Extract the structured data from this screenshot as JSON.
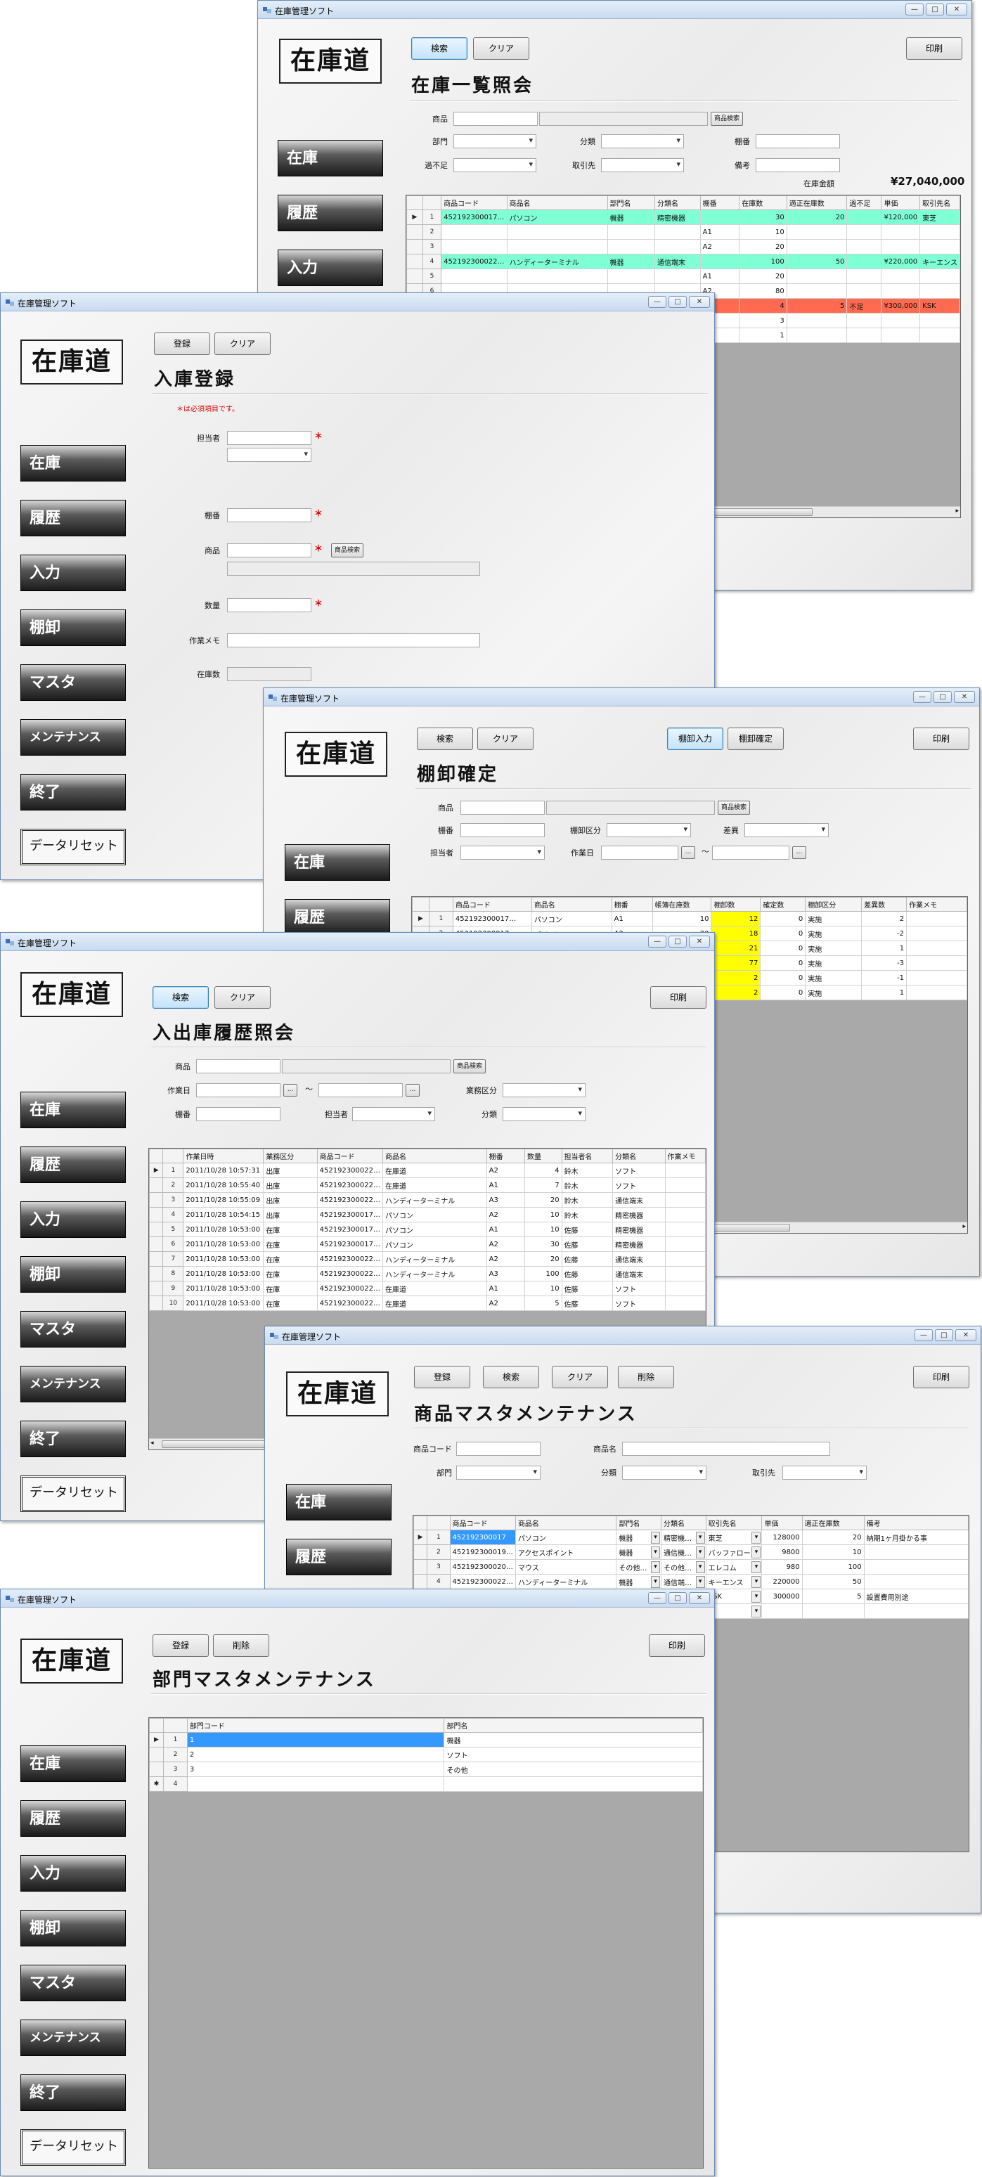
{
  "app_title": "在庫管理ソフト",
  "logo_text": "在庫道",
  "win_controls": {
    "minimize": "—",
    "maximize": "□",
    "close": "✕"
  },
  "menu": {
    "stock": "在庫",
    "history": "履歴",
    "input": "入力",
    "tanaoroshi": "棚卸",
    "master": "マスタ",
    "maint": "メンテナンス",
    "exit": "終了",
    "reset": "データリセット"
  },
  "w1": {
    "btn_search": "検索",
    "btn_clear": "クリア",
    "btn_print": "印刷",
    "page_title": "在庫一覧照会",
    "f_product": "商品",
    "btn_prod_search": "商品検索",
    "f_dept": "部門",
    "f_cat": "分類",
    "f_shelf": "棚番",
    "f_lack": "過不足",
    "f_supplier": "取引先",
    "f_note": "備考",
    "total_label": "在庫金額",
    "total_value": "¥27,040,000",
    "cols": [
      "商品コード",
      "商品名",
      "部門名",
      "分類名",
      "棚番",
      "在庫数",
      "適正在庫数",
      "過不足",
      "単価",
      "取引先名"
    ],
    "rows": [
      {
        "n": "1",
        "cells": [
          "452192300017…",
          "パソコン",
          "機器",
          "精密機器",
          "",
          "30",
          "20",
          "",
          "¥120,000",
          "東芝"
        ]
      },
      {
        "n": "2",
        "cells": [
          "",
          "",
          "",
          "",
          "A1",
          "10",
          "",
          "",
          "",
          ""
        ]
      },
      {
        "n": "3",
        "cells": [
          "",
          "",
          "",
          "",
          "A2",
          "20",
          "",
          "",
          "",
          ""
        ]
      },
      {
        "n": "4",
        "cells": [
          "452192300022…",
          "ハンディーターミナル",
          "機器",
          "通信端末",
          "",
          "100",
          "50",
          "",
          "¥220,000",
          "キーエンス"
        ]
      },
      {
        "n": "5",
        "cells": [
          "",
          "",
          "",
          "",
          "A1",
          "20",
          "",
          "",
          "",
          ""
        ]
      },
      {
        "n": "6",
        "cells": [
          "",
          "",
          "",
          "",
          "A2",
          "80",
          "",
          "",
          "",
          ""
        ]
      },
      {
        "n": "7",
        "cells": [
          "",
          "",
          "",
          "",
          "",
          "4",
          "5",
          "不足",
          "¥300,000",
          "KSK"
        ]
      },
      {
        "n": "8",
        "cells": [
          "",
          "",
          "",
          "",
          "",
          "3",
          "",
          "",
          "",
          ""
        ]
      },
      {
        "n": "9",
        "cells": [
          "",
          "",
          "",
          "",
          "",
          "1",
          "",
          "",
          "",
          ""
        ]
      }
    ]
  },
  "w2": {
    "btn_register": "登録",
    "btn_clear": "クリア",
    "page_title": "入庫登録",
    "required_note": "＊は必須項目です。",
    "f_person": "担当者",
    "f_shelf": "棚番",
    "f_product": "商品",
    "btn_prod_search": "商品検索",
    "f_qty": "数量",
    "f_memo": "作業メモ",
    "f_stock": "在庫数",
    "req_mark": "＊"
  },
  "w3": {
    "btn_search": "検索",
    "btn_clear": "クリア",
    "btn_input": "棚卸入力",
    "btn_confirm": "棚卸確定",
    "btn_print": "印刷",
    "page_title": "棚卸確定",
    "f_product": "商品",
    "btn_prod_search": "商品検索",
    "f_shelf": "棚番",
    "f_tkubun": "棚卸区分",
    "f_diff": "差異",
    "f_person": "担当者",
    "f_workdate": "作業日",
    "tilde": "～",
    "ellipsis": "...",
    "cols": [
      "商品コード",
      "商品名",
      "棚番",
      "帳簿在庫数",
      "棚卸数",
      "確定数",
      "棚卸区分",
      "差異数",
      "作業メモ"
    ],
    "rows": [
      {
        "n": "1",
        "cells": [
          "452192300017…",
          "パソコン",
          "A1",
          "10",
          "12",
          "0",
          "実施",
          "2",
          ""
        ]
      },
      {
        "n": "2",
        "cells": [
          "452192300017…",
          "パソコン",
          "A2",
          "20",
          "18",
          "0",
          "実施",
          "-2",
          ""
        ]
      },
      {
        "n": "3",
        "cells": [
          "",
          "",
          "",
          "",
          "21",
          "0",
          "実施",
          "1",
          ""
        ]
      },
      {
        "n": "4",
        "cells": [
          "",
          "",
          "",
          "",
          "77",
          "0",
          "実施",
          "-3",
          ""
        ]
      },
      {
        "n": "5",
        "cells": [
          "",
          "",
          "",
          "",
          "2",
          "0",
          "実施",
          "-1",
          ""
        ]
      },
      {
        "n": "6",
        "cells": [
          "",
          "",
          "",
          "",
          "2",
          "0",
          "実施",
          "1",
          ""
        ]
      }
    ]
  },
  "w4": {
    "btn_search": "検索",
    "btn_clear": "クリア",
    "btn_print": "印刷",
    "page_title": "入出庫履歴照会",
    "f_product": "商品",
    "btn_prod_search": "商品検索",
    "f_workdate": "作業日",
    "tilde": "～",
    "ellipsis": "...",
    "f_gyomu": "業務区分",
    "f_shelf": "棚番",
    "f_person": "担当者",
    "f_cat": "分類",
    "cols": [
      "作業日時",
      "業務区分",
      "商品コード",
      "商品名",
      "棚番",
      "数量",
      "担当者名",
      "分類名",
      "作業メモ"
    ],
    "rows": [
      {
        "n": "1",
        "cells": [
          "2011/10/28 10:57:31",
          "出庫",
          "452192300022…",
          "在庫道",
          "A2",
          "4",
          "鈴木",
          "ソフト",
          ""
        ]
      },
      {
        "n": "2",
        "cells": [
          "2011/10/28 10:55:40",
          "出庫",
          "452192300022…",
          "在庫道",
          "A1",
          "7",
          "鈴木",
          "ソフト",
          ""
        ]
      },
      {
        "n": "3",
        "cells": [
          "2011/10/28 10:55:09",
          "出庫",
          "452192300022…",
          "ハンディーターミナル",
          "A3",
          "20",
          "鈴木",
          "通信端末",
          ""
        ]
      },
      {
        "n": "4",
        "cells": [
          "2011/10/28 10:54:15",
          "出庫",
          "452192300017…",
          "パソコン",
          "A2",
          "10",
          "鈴木",
          "精密機器",
          ""
        ]
      },
      {
        "n": "5",
        "cells": [
          "2011/10/28 10:53:00",
          "在庫",
          "452192300017…",
          "パソコン",
          "A1",
          "10",
          "佐藤",
          "精密機器",
          ""
        ]
      },
      {
        "n": "6",
        "cells": [
          "2011/10/28 10:53:00",
          "在庫",
          "452192300017…",
          "パソコン",
          "A2",
          "30",
          "佐藤",
          "精密機器",
          ""
        ]
      },
      {
        "n": "7",
        "cells": [
          "2011/10/28 10:53:00",
          "在庫",
          "452192300022…",
          "ハンディーターミナル",
          "A2",
          "20",
          "佐藤",
          "通信端末",
          ""
        ]
      },
      {
        "n": "8",
        "cells": [
          "2011/10/28 10:53:00",
          "在庫",
          "452192300022…",
          "ハンディーターミナル",
          "A3",
          "100",
          "佐藤",
          "通信端末",
          ""
        ]
      },
      {
        "n": "9",
        "cells": [
          "2011/10/28 10:53:00",
          "在庫",
          "452192300022…",
          "在庫道",
          "A1",
          "10",
          "佐藤",
          "ソフト",
          ""
        ]
      },
      {
        "n": "10",
        "cells": [
          "2011/10/28 10:53:00",
          "在庫",
          "452192300022…",
          "在庫道",
          "A2",
          "5",
          "佐藤",
          "ソフト",
          ""
        ]
      }
    ]
  },
  "w5": {
    "btn_register": "登録",
    "btn_search": "検索",
    "btn_clear": "クリア",
    "btn_delete": "削除",
    "btn_print": "印刷",
    "page_title": "商品マスタメンテナンス",
    "f_code": "商品コード",
    "f_name": "商品名",
    "f_dept": "部門",
    "f_cat": "分類",
    "f_supplier": "取引先",
    "cols": [
      "商品コード",
      "商品名",
      "部門名",
      "分類名",
      "取引先名",
      "単価",
      "適正在庫数",
      "備考"
    ],
    "rows": [
      {
        "n": "1",
        "cells": [
          "452192300017",
          "パソコン",
          "機器",
          "精密機…",
          "東芝",
          "128000",
          "20",
          "納期1ヶ月掛かる事"
        ]
      },
      {
        "n": "2",
        "cells": [
          "452192300019…",
          "アクセスポイント",
          "機器",
          "通信機…",
          "バッファロー",
          "9800",
          "10",
          ""
        ]
      },
      {
        "n": "3",
        "cells": [
          "452192300020…",
          "マウス",
          "その他…",
          "その他…",
          "エレコム",
          "980",
          "100",
          ""
        ]
      },
      {
        "n": "4",
        "cells": [
          "452192300022…",
          "ハンディーターミナル",
          "機器",
          "通信端…",
          "キーエンス",
          "220000",
          "50",
          ""
        ]
      },
      {
        "n": "5",
        "cells": [
          "",
          "",
          "",
          "",
          "KSK",
          "300000",
          "5",
          "設置費用別途"
        ]
      },
      {
        "n": "6",
        "cells": [
          "",
          "",
          "",
          "",
          "",
          "",
          "",
          ""
        ]
      }
    ]
  },
  "w6": {
    "btn_register": "登録",
    "btn_delete": "削除",
    "btn_print": "印刷",
    "page_title": "部門マスタメンテナンス",
    "cols": [
      "部門コード",
      "部門名"
    ],
    "rows": [
      {
        "n": "1",
        "cells": [
          "1",
          "機器"
        ]
      },
      {
        "n": "2",
        "cells": [
          "2",
          "ソフト"
        ]
      },
      {
        "n": "3",
        "cells": [
          "3",
          "その他"
        ]
      },
      {
        "n": "4",
        "cells": [
          "",
          ""
        ]
      }
    ]
  }
}
